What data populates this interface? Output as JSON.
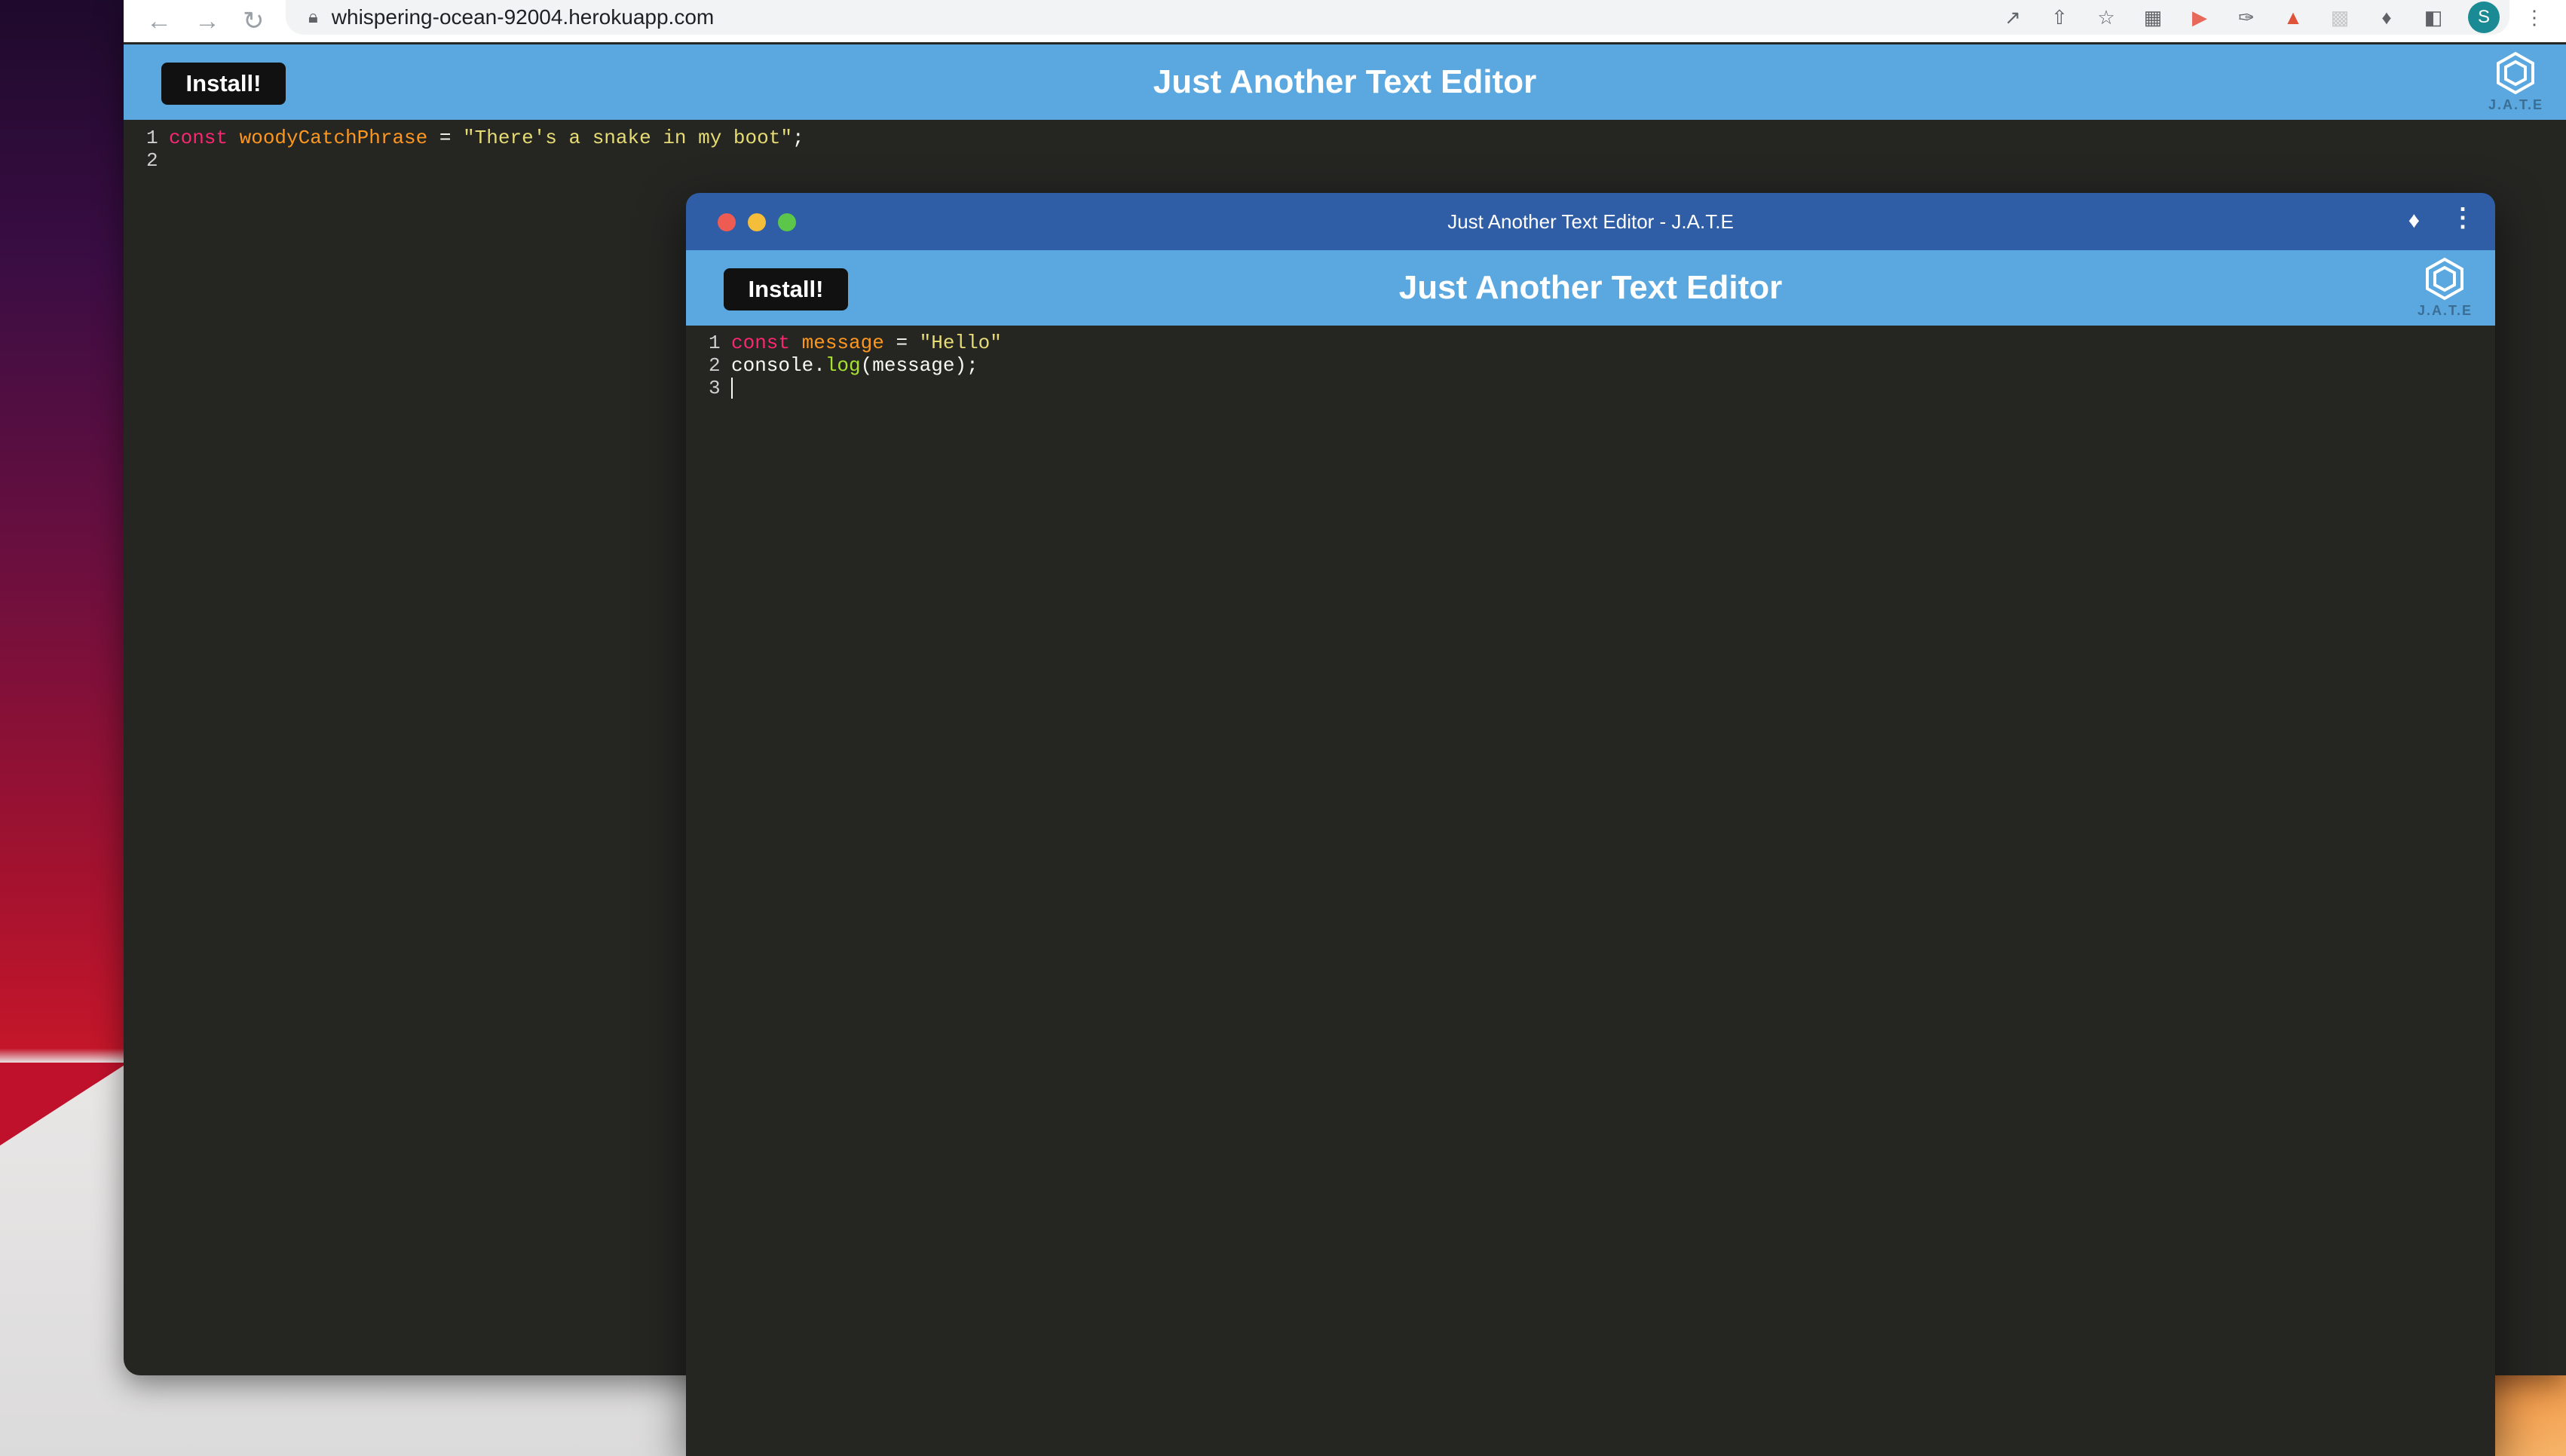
{
  "browser": {
    "url": "whispering-ocean-92004.herokuapp.com",
    "profile_initial": "S"
  },
  "app": {
    "install_label": "Install!",
    "title": "Just Another Text Editor",
    "logo_text": "J.A.T.E"
  },
  "main_editor": {
    "line_numbers": [
      "1",
      "2"
    ],
    "line1": {
      "keyword": "const",
      "variable": "woodyCatchPhrase",
      "operator": " = ",
      "string": "\"There's a snake in my boot\"",
      "end": ";"
    }
  },
  "pwa_window": {
    "window_title": "Just Another Text Editor - J.A.T.E",
    "line_numbers": [
      "1",
      "2",
      "3"
    ],
    "line1": {
      "keyword": "const",
      "variable": "message",
      "operator": " = ",
      "string": "\"Hello\""
    },
    "line2": {
      "object": "console.",
      "method": "log",
      "args": "(message);"
    }
  },
  "colors": {
    "header_blue": "#5aa8df",
    "titlebar_blue": "#2f5ea6",
    "editor_bg": "#252622",
    "keyword": "#f92672",
    "variable": "#fd971f",
    "string": "#e6db74",
    "function": "#a6e22e"
  },
  "icons": [
    "back-arrow-icon",
    "forward-arrow-icon",
    "reload-icon",
    "lock-icon",
    "open-external-icon",
    "share-icon",
    "star-icon",
    "extension-icon",
    "kebab-menu-icon",
    "jate-logo-icon"
  ]
}
